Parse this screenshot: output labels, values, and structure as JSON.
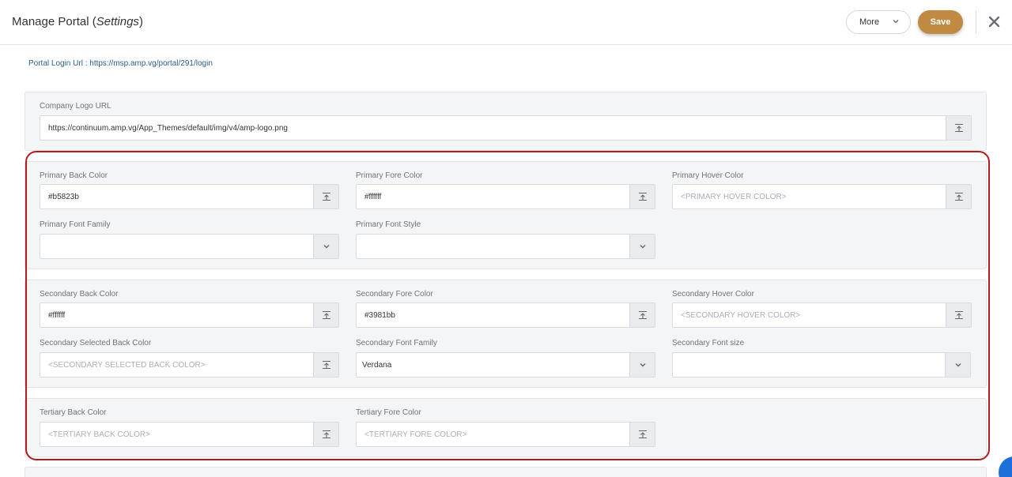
{
  "header": {
    "title_main": "Manage Portal (",
    "title_italic": "Settings",
    "title_end": ")",
    "more_label": "More",
    "save_label": "Save"
  },
  "portal_url_text": "Portal Login Url : https://msp.amp.vg/portal/291/login",
  "logo": {
    "label": "Company Logo URL",
    "value": "https://continuum.amp.vg/App_Themes/default/img/v4/amp-logo.png"
  },
  "primary": {
    "back_label": "Primary Back Color",
    "back_value": "#b5823b",
    "fore_label": "Primary Fore Color",
    "fore_value": "#ffffff",
    "hover_label": "Primary Hover Color",
    "hover_placeholder": "<PRIMARY HOVER COLOR>",
    "font_family_label": "Primary Font Family",
    "font_family_value": "",
    "font_style_label": "Primary Font Style",
    "font_style_value": ""
  },
  "secondary": {
    "back_label": "Secondary Back Color",
    "back_value": "#ffffff",
    "fore_label": "Secondary Fore Color",
    "fore_value": "#3981bb",
    "hover_label": "Secondary Hover Color",
    "hover_placeholder": "<SECONDARY HOVER COLOR>",
    "selected_back_label": "Secondary Selected Back Color",
    "selected_back_placeholder": "<SECONDARY SELECTED BACK COLOR>",
    "font_family_label": "Secondary Font Family",
    "font_family_value": "Verdana",
    "font_size_label": "Secondary Font size",
    "font_size_value": ""
  },
  "tertiary": {
    "back_label": "Tertiary Back Color",
    "back_placeholder": "<TERTIARY BACK COLOR>",
    "fore_label": "Tertiary Fore Color",
    "fore_placeholder": "<TERTIARY FORE COLOR>"
  },
  "colors": {
    "accent": "#c08a43",
    "highlight": "#b51a1f",
    "link": "#2a5e8c"
  }
}
